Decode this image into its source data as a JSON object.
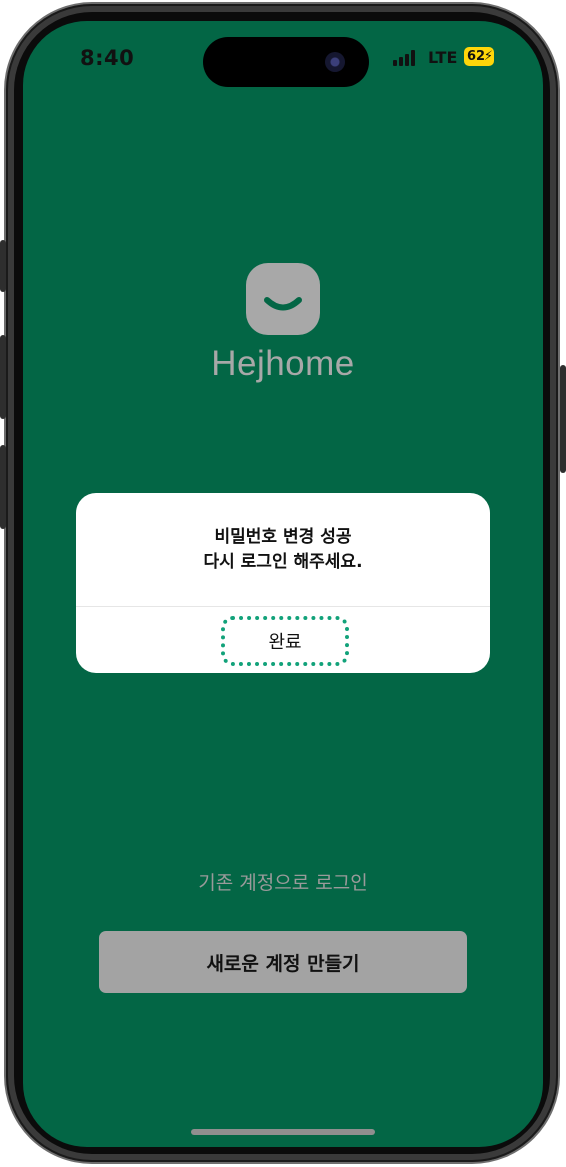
{
  "status_bar": {
    "time": "8:40",
    "network": "LTE",
    "battery": "62",
    "battery_color": "#ffd60a"
  },
  "brand": {
    "name": "Hejhome",
    "logo_icon": "smile-icon"
  },
  "alert": {
    "title_line1": "비밀번호 변경 성공",
    "title_line2": "다시 로그인 해주세요.",
    "confirm_label": "완료"
  },
  "actions": {
    "existing_login": "기존 계정으로 로그인",
    "create_account": "새로운 계정 만들기"
  },
  "colors": {
    "background": "#036645",
    "muted_text": "#9a9a9a",
    "button_bg": "#a3a3a3",
    "highlight": "#12a27a"
  }
}
